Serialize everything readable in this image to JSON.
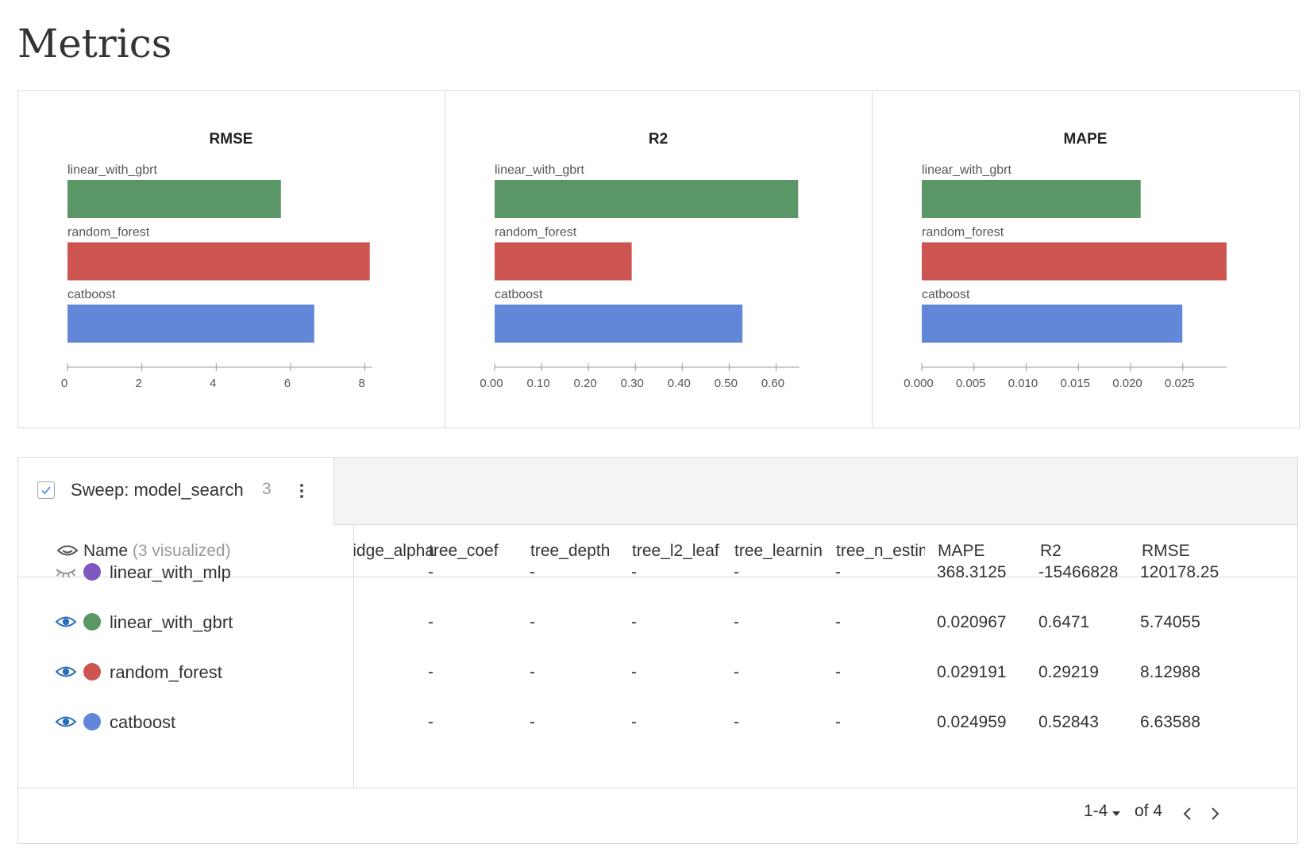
{
  "page": {
    "title": "Metrics"
  },
  "colors": {
    "linear_with_mlp": "#7e57c2",
    "linear_with_gbrt": "#5b9766",
    "random_forest": "#cd5551",
    "catboost": "#6286d8"
  },
  "chart_data": [
    {
      "type": "bar",
      "orientation": "horizontal",
      "title": "RMSE",
      "categories": [
        "linear_with_gbrt",
        "random_forest",
        "catboost"
      ],
      "values": [
        5.74055,
        8.12988,
        6.63588
      ],
      "colors": [
        "#5b9766",
        "#cd5551",
        "#6286d8"
      ],
      "xlim": [
        0,
        8.2
      ],
      "ticks": [
        0,
        2,
        4,
        6,
        8
      ],
      "tick_labels": [
        "0",
        "2",
        "4",
        "6",
        "8"
      ]
    },
    {
      "type": "bar",
      "orientation": "horizontal",
      "title": "R2",
      "categories": [
        "linear_with_gbrt",
        "random_forest",
        "catboost"
      ],
      "values": [
        0.6471,
        0.29219,
        0.52843
      ],
      "colors": [
        "#5b9766",
        "#cd5551",
        "#6286d8"
      ],
      "xlim": [
        0,
        0.65
      ],
      "ticks": [
        0,
        0.1,
        0.2,
        0.3,
        0.4,
        0.5,
        0.6
      ],
      "tick_labels": [
        "0.00",
        "0.10",
        "0.20",
        "0.30",
        "0.40",
        "0.50",
        "0.60"
      ]
    },
    {
      "type": "bar",
      "orientation": "horizontal",
      "title": "MAPE",
      "categories": [
        "linear_with_gbrt",
        "random_forest",
        "catboost"
      ],
      "values": [
        0.020967,
        0.029191,
        0.024959
      ],
      "colors": [
        "#5b9766",
        "#cd5551",
        "#6286d8"
      ],
      "xlim": [
        0,
        0.0292
      ],
      "ticks": [
        0,
        0.005,
        0.01,
        0.015,
        0.02,
        0.025
      ],
      "tick_labels": [
        "0.000",
        "0.005",
        "0.010",
        "0.015",
        "0.020",
        "0.025"
      ]
    }
  ],
  "runs_table": {
    "sweep_label": "Sweep: model_search",
    "sweep_count": "3",
    "name_header": "Name",
    "visualized_note": "(3 visualized)",
    "columns": [
      "idge_alpha",
      "tree_coef",
      "tree_depth",
      "tree_l2_leaf",
      "tree_learning",
      "tree_n_estim",
      "MAPE",
      "R2",
      "RMSE"
    ],
    "rows": [
      {
        "name": "linear_with_mlp",
        "visible": false,
        "color": "#7e57c2",
        "cells": [
          "",
          "-",
          "-",
          "-",
          "-",
          "-",
          "368.3125",
          "-15466828",
          "120178.25"
        ]
      },
      {
        "name": "linear_with_gbrt",
        "visible": true,
        "color": "#5b9766",
        "cells": [
          "",
          "-",
          "-",
          "-",
          "-",
          "-",
          "0.020967",
          "0.6471",
          "5.74055"
        ]
      },
      {
        "name": "random_forest",
        "visible": true,
        "color": "#cd5551",
        "cells": [
          "",
          "-",
          "-",
          "-",
          "-",
          "-",
          "0.029191",
          "0.29219",
          "8.12988"
        ]
      },
      {
        "name": "catboost",
        "visible": true,
        "color": "#6286d8",
        "cells": [
          "",
          "-",
          "-",
          "-",
          "-",
          "-",
          "0.024959",
          "0.52843",
          "6.63588"
        ]
      }
    ],
    "pagination": {
      "range": "1-4",
      "of": "of 4"
    }
  }
}
